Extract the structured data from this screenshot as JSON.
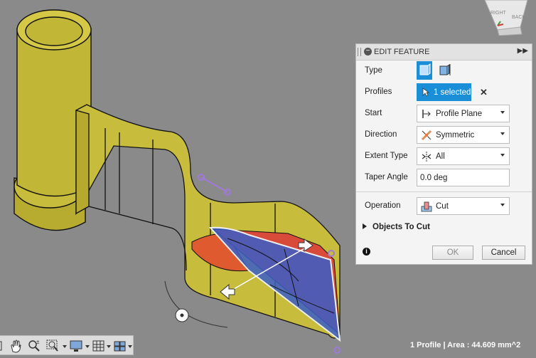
{
  "panel": {
    "title": "EDIT FEATURE",
    "rows": {
      "type": "Type",
      "profiles": "Profiles",
      "profiles_value": "1 selected",
      "start": "Start",
      "start_value": "Profile Plane",
      "direction": "Direction",
      "direction_value": "Symmetric",
      "extent_type": "Extent Type",
      "extent_value": "All",
      "taper_angle": "Taper Angle",
      "taper_value": "0.0 deg",
      "operation": "Operation",
      "operation_value": "Cut"
    },
    "objects_to_cut": "Objects To Cut",
    "ok": "OK",
    "cancel": "Cancel"
  },
  "viewcube": {
    "right_label": "RIGHT",
    "back_label": "BACK"
  },
  "status": "1 Profile | Area : 44.609 mm^2",
  "colors": {
    "accent": "#1a8fd8",
    "model": "#c8bc3c",
    "cut_blue": "#3a5ec8",
    "cut_red": "#d84a3a"
  }
}
